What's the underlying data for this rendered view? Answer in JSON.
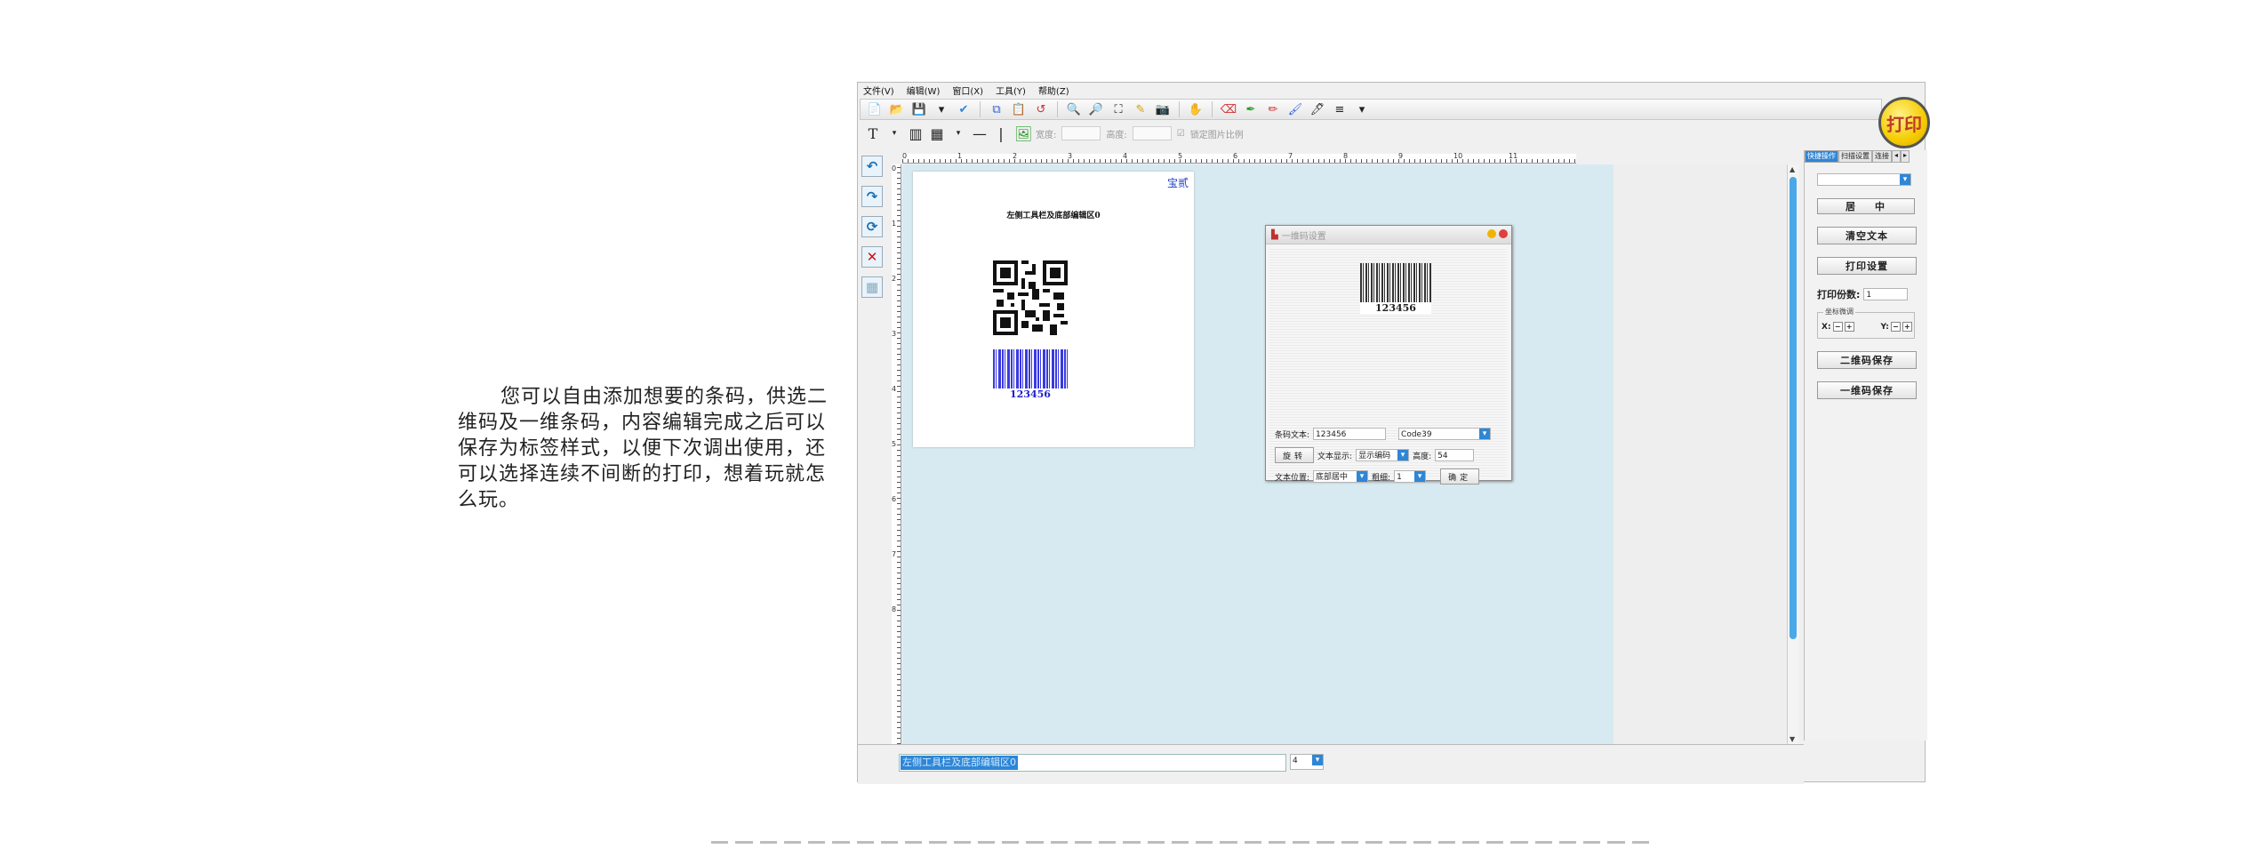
{
  "description": "您可以自由添加想要的条码，供选二维码及一维条码，内容编辑完成之后可以保存为标签样式，以便下次调出使用，还可以选择连续不间断的打印，想着玩就怎么玩。",
  "menu": [
    "文件(V)",
    "编辑(W)",
    "窗口(X)",
    "工具(Y)",
    "帮助(Z)"
  ],
  "print_button": "打印",
  "toolbar2": {
    "width_label": "宽度:",
    "height_label": "高度:",
    "lock_ratio": "锁定图片比例"
  },
  "ruler_h": [
    "0",
    "1",
    "2",
    "3",
    "4",
    "5",
    "6",
    "7",
    "8",
    "9",
    "10",
    "11"
  ],
  "ruler_v": [
    "0",
    "1",
    "2",
    "3",
    "4",
    "5",
    "6",
    "7",
    "8"
  ],
  "label": {
    "corner_text": "宝贰",
    "title": "左侧工具栏及底部编辑区0",
    "barcode_text": "123456"
  },
  "dialog": {
    "title": "一维码设置",
    "preview_text": "123456",
    "fields": {
      "text_label": "条码文本:",
      "text_value": "123456",
      "type_value": "Code39",
      "rotate_button": "旋转",
      "display_label": "文本显示:",
      "display_value": "显示编码",
      "height_label": "高度:",
      "height_value": "54",
      "position_label": "文本位置:",
      "position_value": "底部居中",
      "thickness_label": "粗细:",
      "thickness_value": "1",
      "ok_button": "确定"
    }
  },
  "right_panel": {
    "tabs": [
      "快捷操作",
      "扫描设置",
      "连接"
    ],
    "center_button": "居中",
    "clear_text_button": "清空文本",
    "print_settings_button": "打印设置",
    "copies_label": "打印份数:",
    "copies_value": "1",
    "fine_tune_label": "坐标微调",
    "x_label": "X:",
    "y_label": "Y:",
    "qr_save_button": "二维码保存",
    "barcode_save_button": "一维码保存"
  },
  "bottom": {
    "edit_text": "左侧工具栏及底部编辑区0",
    "size_value": "4"
  }
}
